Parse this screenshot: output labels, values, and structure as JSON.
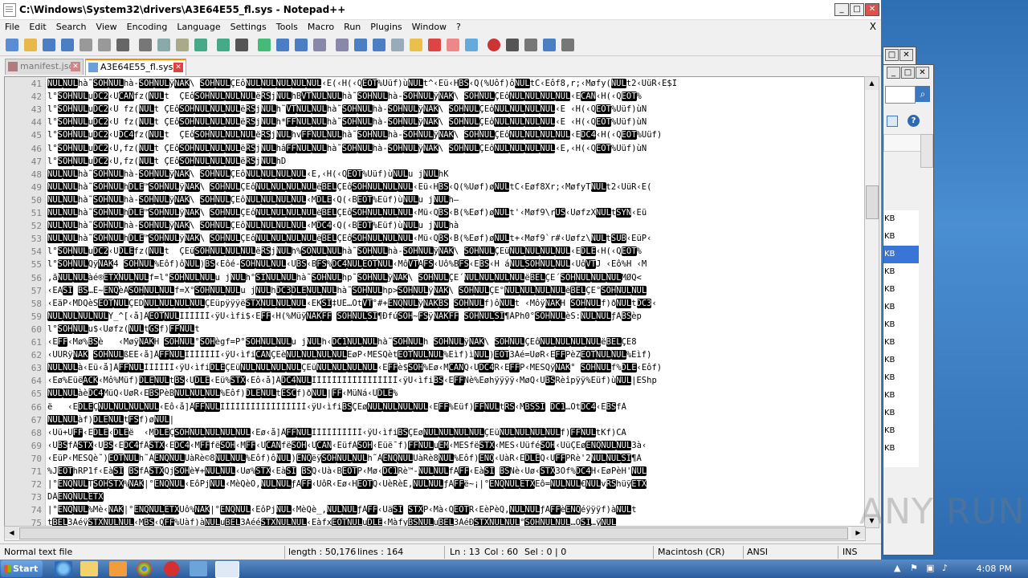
{
  "window": {
    "title": "C:\\Windows\\System32\\drivers\\A3E64E55_fl.sys - Notepad++",
    "controls": [
      "_",
      "□",
      "✕"
    ]
  },
  "menu": [
    "File",
    "Edit",
    "Search",
    "View",
    "Encoding",
    "Language",
    "Settings",
    "Tools",
    "Macro",
    "Run",
    "Plugins",
    "Window",
    "?"
  ],
  "menu_close": "X",
  "toolbar": {
    "icons": [
      "new-file",
      "open-file",
      "save",
      "save-all",
      "close",
      "close-all",
      "print",
      "cut",
      "copy",
      "paste",
      "undo",
      "redo",
      "find",
      "replace",
      "zoom-in",
      "zoom-out",
      "sync-vertical",
      "sync-horizontal",
      "word-wrap",
      "show-all-chars",
      "indent-guide",
      "doc-map",
      "function-list",
      "folder-as-workspace",
      "monitoring",
      "record-macro",
      "stop-record",
      "playback",
      "run-macro-multiple",
      "save-macro"
    ]
  },
  "tabs": [
    {
      "label": "manifest.json",
      "active": false
    },
    {
      "label": "A3E64E55_fl.sys",
      "active": true
    }
  ],
  "editor": {
    "lines": [
      {
        "n": "41",
        "t": "NULNULhà˜SOHNULhà-SOHNULÿNAK\\ SOHNULÇEôNULNULNULNULNUL‹E(‹H(‹QEOT%Uüf)ùNULt^‹Eü‹HBS‹Q(%Uôf)ôNULtC‹Eôf8,r;‹Møfy(NULt2‹UüR‹E$I"
      },
      {
        "n": "42",
        "t": "l°SOHNULuDC2‹UCANfz(NULt  ÇEôSOHNULNULNULëRSjNULhBVTNULNULhà˜SOHNULhà-SOHNULÿNAK\\ SOHNULÇEôNULNULNULNUL‹ECAN‹H(‹QEOT%"
      },
      {
        "n": "43",
        "t": "l°SOHNULuDC2‹U fz(NULt ÇEôSOHNULNULNULëRSjNULh˜VTNULNULhà˜SOHNULhà-SOHNULÿNAK\\ SOHNULÇEôNULNULNULNUL‹E ‹H(‹QEOT%Uüf)ùN"
      },
      {
        "n": "44",
        "t": "l°SOHNULuDC2‹U fz(NULt ÇEôSOHNULNULNULëRSjNULh*FFNULNULhà˜SOHNULhà-SOHNULÿNAK\\ SOHNULÇEôNULNULNULNUL‹E ‹H(‹QEOT%Uüf)ùN"
      },
      {
        "n": "45",
        "t": "l°SOHNULuDC2‹UDC4fz(NULt  ÇEôSOHNULNULNULëRSjNULhvFFNULNULhà˜SOHNULhà-SOHNULÿNAK\\ SOHNULÇEôNULNULNULNUL‹EDC4‹H(‹QEOT%Uüf)"
      },
      {
        "n": "46",
        "t": "l°SOHNULuDC2‹U,fz(NULt ÇEôSOHNULNULNULëRSjNULhâFFNULNULhà˜SOHNULhà-SOHNULÿNAK\\ SOHNULÇEôNULNULNULNUL‹E,‹H(‹QEOT%Uüf)ùN"
      },
      {
        "n": "47",
        "t": "l°SOHNULuDC2‹U,fz(NULt ÇEôSOHNULNULNULëRSjNULhD"
      },
      {
        "n": "48",
        "t": "NULNULhà˜SOHNULhà-SOHNULÿNAK\\ SOHNULÇEôNULNULNULNUL‹E,‹H(‹QEOT%Uüf)ùNULu jNULhK"
      },
      {
        "n": "49",
        "t": "NULNULhà˜SOHNULhDLE™SOHNULÿNAK\\ SOHNULÇEôNULNULNULNULëBELÇEôSOHNULNULNUL‹Eü‹HBS‹Q(%Uøf)øNULtC‹Eøf8Xr;‹MøfyTNULt2‹UüR‹E("
      },
      {
        "n": "50",
        "t": "NULNULhà˜SOHNULhà-SOHNULÿNAK\\ SOHNULÇEôNULNULNULNUL‹MDLE‹Q(‹BEOT%Eüf)ùNULu jNULh—"
      },
      {
        "n": "51",
        "t": "NULNULhà˜SOHNULhDLE™SOHNULÿNAK\\ SOHNULÇEôNULNULNULNULëBELÇEôSOHNULNULNUL‹Mü‹QBS‹B(%Eøf)øNULt'‹Møf9\\rUS‹UøfzXNULtSYN‹Eü"
      },
      {
        "n": "52",
        "t": "NULNULhà˜SOHNULhà-SOHNULÿNAK\\ SOHNULÇEôNULNULNULNUL‹MDC4‹Q(‹BEOT%Eüf)ùNULu jNULhà"
      },
      {
        "n": "53",
        "t": "NULNULhà˜SOHNULhDLE™SOHNULÿNAK\\ SOHNULÇEôNULNULNULNULëBELÇEôSOHNULNULNUL‹Mü‹QBS‹B(%Eøf)øNULt+‹Møf9`r#‹Uøfz\\NULtSUB‹EüP‹"
      },
      {
        "n": "54",
        "t": "l°SOHNULuDC2‹UDLEfz(NULt  ÇEüSOHNULNULNULëRSjNULh%SONULNULhà˜SOHNULhà-SOHNULÿNAK\\ SOHNULÇEüNULNULNULNUL‹EDLE‹H(‹QEOT%"
      },
      {
        "n": "55",
        "t": "l°SOHNULQÿNAK4 SOHNUL%Eôf)ôNUL)BS‹Eôé-SOHNULNUL‹UBS‹BFS%DC4NULEOTNUL‹MôVTAFS‹Uô%BFS‹EBS‹H áNULSOHNULNUL‹UôVTJ ‹Eô%H ‹M"
      },
      {
        "n": "56",
        "t": ",ãNULNULàé®ETXNULNULf=l°SOHNULNULu jNULh°SINULNULhà˜SOHNULhp˜SOHNULÿNAK\\ SOHNULÇE´NULNULNULNULëBELÇE´SOHNULNULNULMØQ<"
      },
      {
        "n": "57",
        "t": "‹EÄSI BS…È~ENQèÂSOHNULNULf=X°SOHNULNULu jNULhDC3DLENULNULhà˜SOHNULhp>SOHNULÿNAK\\ SOHNULÇE°NULNULNULNULëBELÇE°SOHNULNUL"
      },
      {
        "n": "58",
        "t": "‹EäP‹MDQèSEOTNULÇEDNULNULNULNULÇEüpÿÿÿëSTXNULNULNUL‹EKSI‡UÈ…ÒtVT°#+ENQNULÿNAKBS SOHNULf)ôNULt ‹MôÿNAKH SOHNULf)ðNULtDC3‹"
      },
      {
        "n": "59",
        "t": "NULNULNULNULY_^[‹å]ÂEOTNULÌÌÌÌÌÌ‹ÿU‹ìfi$‹EFF‹H(%MüÿNAKFF SOHNULSI¶ÐfúSOH~FSÿNAKFF SOHNULSI¶ÀPh0°SOHNULèS:NULNULƒÄBSèp"
      },
      {
        "n": "60",
        "t": "l°SOHNULu$‹Uøfz(NULtGSf)FFNULt"
      },
      {
        "n": "61",
        "t": "‹EFF‹Mø%BSè   ‹MøÿNAKH SOHNUL°SOHègf=P°SOHNULNULu jNULh‹DC1NULNULhà˜SOHNULh SOHNULÿNAK\\ SOHNULÇEôNULNULNULNULëBELÇE8"
      },
      {
        "n": "62",
        "t": "‹UÜRÿNAK SOHNULßEE‹å]ÂFFNULÌÌÌÌÌÌÌ‹ÿU‹ìfiCANÇEèNULNULNULNULEøP‹MESQètEOTNULNUL%Eìf)ìNUL)EOT3Àé=UøR‹EFFPèZEOTNULNUL%Eìf)"
      },
      {
        "n": "63",
        "t": "NULNULà‹Eü‹å]ÂFFNULÌÌÌÌÌÌ‹ÿU‹ìfiDLEÇEüNULNULNULNULÇEüNULNULNULNUL‹EFFè$SOH%Eø‹MCANQ‹UDC4R‹EFFP‹MESQÿNAK° SOHNULf%DLE‹Eôf)"
      },
      {
        "n": "64",
        "t": "‹Eø%EüëACK‹Mô%Müf)DLENULtBS‹UDLE‹Eü%STX‹Eô‹å]ÂDC4NULÌÌÌÌÌÌÌÌÌÌÌÌÌÌÌÌÌ‹ÿU‹ìfiBS‹EFFÑè%Eøhÿÿÿÿ‹MøQ‹UBSRèîpÿÿ%Eüf)ùNUL|EShp"
      },
      {
        "n": "65",
        "t": "NULNULàèDC4MüQ‹UøR‹EBSPèBNULNULNUL%Eôf)DLENULtESCf)ðNUL|FF‹MüÑá‹UDLE%"
      },
      {
        "n": "66",
        "t": "ë   ‹EDLEÇNULNULNULNUL‹Eô‹å]ÂFFNULÌÌÌÌÌÌÌÌÌÌÌÌÌÌÌÌÌ‹ÿU‹ìfiBSÇEøNULNULNULNUL‹EFF%Eüf)FFNULtRS‹MBSSI DC1…ÒtDC4‹EBSfÀ"
      },
      {
        "n": "67",
        "t": "NULNULàf)DLENULtFSf)øNUL|"
      },
      {
        "n": "68",
        "t": "‹Uü+UFF‹EDLE‹DLEë  ‹MDLEÇSOHNULNULNULNUL‹Eø‹å]ÂFFNULÌÌÌÌÌÌÌÌÌÌ‹ÿU‹ìfiBSÇEøNULNULNULNULÇEüNULNULNULNULf)FFNULtKf)CA"
      },
      {
        "n": "69",
        "t": "‹UBSfÂSTX‹UBS‹EDC4fÂSTX‹EDC4‹MFFfëSOH‹MFF‹UCANfëSOH‹UCAN‹EüfÀSOH‹Eüë¯f)FFNULuEM‹MESfëSTX‹MES‹ÜüféSOH‹UüÇEøENQNULNUL3à‹"
      },
      {
        "n": "70",
        "t": "‹EüP‹MESQè˜)EOTNULh˜ÁENQNULUàRè©8NULNUL%Eôf)ôNUL)ENQëÿSOHNULNULh˜ÁENQNULUàRè8NUL%Eôf)ENQ‹UàR‹EDLEQ‹UFFPRè'2NULNULSI¶À"
      },
      {
        "n": "71",
        "t": "%JEOThRP1f‹EàSI BSfÀSTXQjSOHè¥+NULNUL‹Uø%STX‹EàSI BSQ‹Uà‹BEOTP‹Mø‹DC1Rè™-NULNULfÄFF‹EàSI BSÑè‹Uø‹STX3Òf%DC4H‹EøPèH'NUL"
      },
      {
        "n": "72",
        "t": "|°ENQNULTSOHSTX%NAK|°ENQNUL‹EôPjNUL‹MèQèÕ,NULNULƒÄFF‹UôR‹Eø‹HEOTQ‹UèRèÈ,NULNULƒÄFFë~¡|°ENQNULETXEô=NULNUL€NULvRShüÿETX"
      },
      {
        "n": "73",
        "t": "DÂENQNULETX"
      },
      {
        "n": "74",
        "t": "|°ENQNUL%Mè‹NAK|°ENQNULETXUô%NAK|°ENQNUL‹EôPjNUL‹MèQè_,NULNULƒÄFF‹UäSI STXP‹Mà‹QEOTR‹EèPèQ,NULNULƒÄFFèENQéÿÿÿf)àNULt"
      },
      {
        "n": "75",
        "t": "tBEL3ÀéÿSTXNULNUL‹MBS‹QFF%Uàf)àNULuBEL3ÀééSTXNULNUL‹EàfxEOTNULuDLE‹MàfyBSNULuBEL3ÀéÐSTXNULNUL°SOHNULNUL…ÒSI…ÿNUL"
      }
    ]
  },
  "status": {
    "filetype": "Normal text file",
    "length": "length : 50,176",
    "lines": "lines : 164",
    "position": "Ln : 13",
    "col": "Col : 60",
    "sel": "Sel : 0 | 0",
    "eol": "Macintosh (CR)",
    "encoding": "ANSI",
    "mode": "INS"
  },
  "background_window": {
    "kb_items": [
      "KB",
      "KB",
      "KB",
      "KB",
      "KB",
      "KB",
      "KB",
      "KB",
      "KB",
      "KB",
      "KB",
      "KB",
      "KB",
      "KB"
    ],
    "selected_index": 2
  },
  "taskbar": {
    "start": "Start",
    "clock": "4:08 PM"
  },
  "watermark": "ANY RUN",
  "colors": {
    "accent": "#fa8c00",
    "selection": "#3875d7",
    "control_char_bg": "#000000"
  }
}
